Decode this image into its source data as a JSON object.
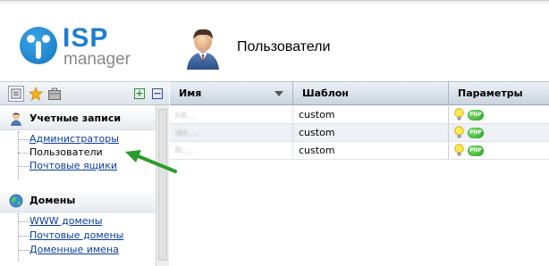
{
  "header": {
    "logo_top": "ISP",
    "logo_bottom": "manager",
    "page_title": "Пользователи"
  },
  "sidebar": {
    "groups": [
      {
        "label": "Учетные записи",
        "icon": "user-icon",
        "items": [
          {
            "label": "Администраторы",
            "type": "link"
          },
          {
            "label": "Пользователи",
            "type": "current"
          },
          {
            "label": "Почтовые ящики",
            "type": "link"
          }
        ]
      },
      {
        "label": "Домены",
        "icon": "globe-icon",
        "items": [
          {
            "label": "WWW домены",
            "type": "link"
          },
          {
            "label": "Почтовые домены",
            "type": "link"
          },
          {
            "label": "Доменные имена",
            "type": "link"
          }
        ]
      }
    ],
    "toolbar": {
      "icons": [
        "list-view-icon",
        "favorites-star-icon",
        "briefcase-icon"
      ],
      "expand": "+",
      "collapse": "−"
    }
  },
  "table": {
    "columns": [
      "Имя",
      "Шаблон",
      "Параметры"
    ],
    "rows": [
      {
        "name": "ce…",
        "template": "custom",
        "params": [
          "bulb-icon",
          "php-icon"
        ]
      },
      {
        "name": "de…",
        "template": "custom",
        "params": [
          "bulb-icon",
          "php-icon"
        ]
      },
      {
        "name": "fr…",
        "template": "custom",
        "params": [
          "bulb-icon",
          "php-icon"
        ]
      }
    ]
  },
  "colors": {
    "brand": "#1e7dd0",
    "link": "#0a3c9e",
    "arrow": "#2a9d2a"
  }
}
